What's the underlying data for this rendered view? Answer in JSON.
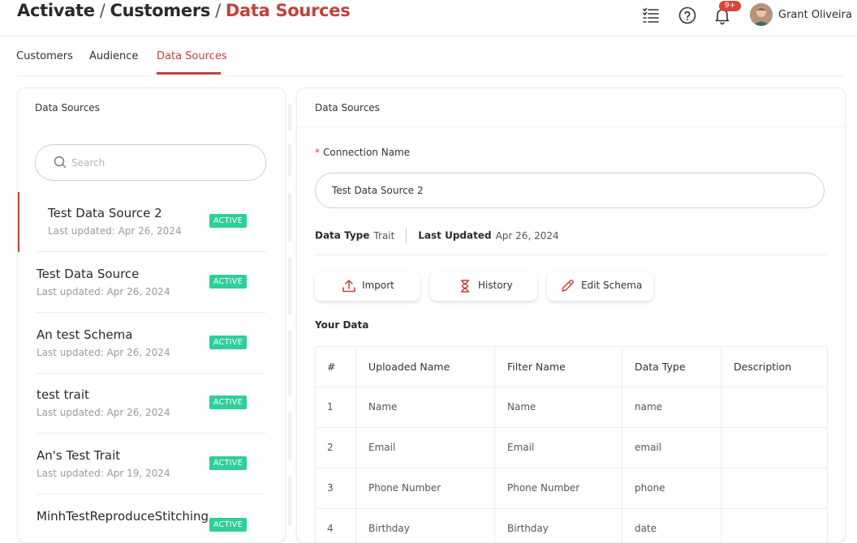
{
  "header": {
    "breadcrumb": [
      "Activate",
      "Customers",
      "Data Sources"
    ],
    "separator": "/",
    "notifications_badge": "9+",
    "user_name": "Grant Oliveira",
    "icons": [
      "list-icon",
      "help-icon",
      "bell-icon",
      "avatar"
    ]
  },
  "tabs": [
    {
      "label": "Customers",
      "active": false
    },
    {
      "label": "Audience",
      "active": false
    },
    {
      "label": "Data Sources",
      "active": true
    }
  ],
  "sidebar": {
    "title": "Data Sources",
    "search_placeholder": "Search",
    "items": [
      {
        "name": "Test Data Source 2",
        "updated": "Last updated: Apr 26, 2024",
        "status": "ACTIVE",
        "selected": true
      },
      {
        "name": "Test Data Source",
        "updated": "Last updated: Apr 26, 2024",
        "status": "ACTIVE",
        "selected": false
      },
      {
        "name": "An test Schema",
        "updated": "Last updated: Apr 26, 2024",
        "status": "ACTIVE",
        "selected": false
      },
      {
        "name": "test trait",
        "updated": "Last updated: Apr 26, 2024",
        "status": "ACTIVE",
        "selected": false
      },
      {
        "name": "An's Test Trait",
        "updated": "Last updated: Apr 19, 2024",
        "status": "ACTIVE",
        "selected": false
      },
      {
        "name": "MinhTestReproduceStitching",
        "updated": "",
        "status": "ACTIVE",
        "selected": false
      }
    ]
  },
  "detail": {
    "title": "Data Sources",
    "required_mark": "*",
    "connection_label": "Connection Name",
    "connection_value": "Test Data Source 2",
    "data_type_label": "Data Type",
    "data_type_value": "Trait",
    "last_updated_label": "Last Updated",
    "last_updated_value": "Apr 26, 2024",
    "buttons": {
      "import": "Import",
      "history": "History",
      "edit_schema": "Edit Schema"
    },
    "your_data_label": "Your Data",
    "table": {
      "columns": [
        "#",
        "Uploaded Name",
        "Filter Name",
        "Data Type",
        "Description"
      ],
      "rows": [
        [
          "1",
          "Name",
          "Name",
          "name",
          ""
        ],
        [
          "2",
          "Email",
          "Email",
          "email",
          ""
        ],
        [
          "3",
          "Phone Number",
          "Phone Number",
          "phone",
          ""
        ],
        [
          "4",
          "Birthday",
          "Birthday",
          "date",
          ""
        ]
      ]
    }
  },
  "colors": {
    "accent": "#c0433a",
    "status": "#2ecf9a",
    "badge": "#d9453b"
  }
}
